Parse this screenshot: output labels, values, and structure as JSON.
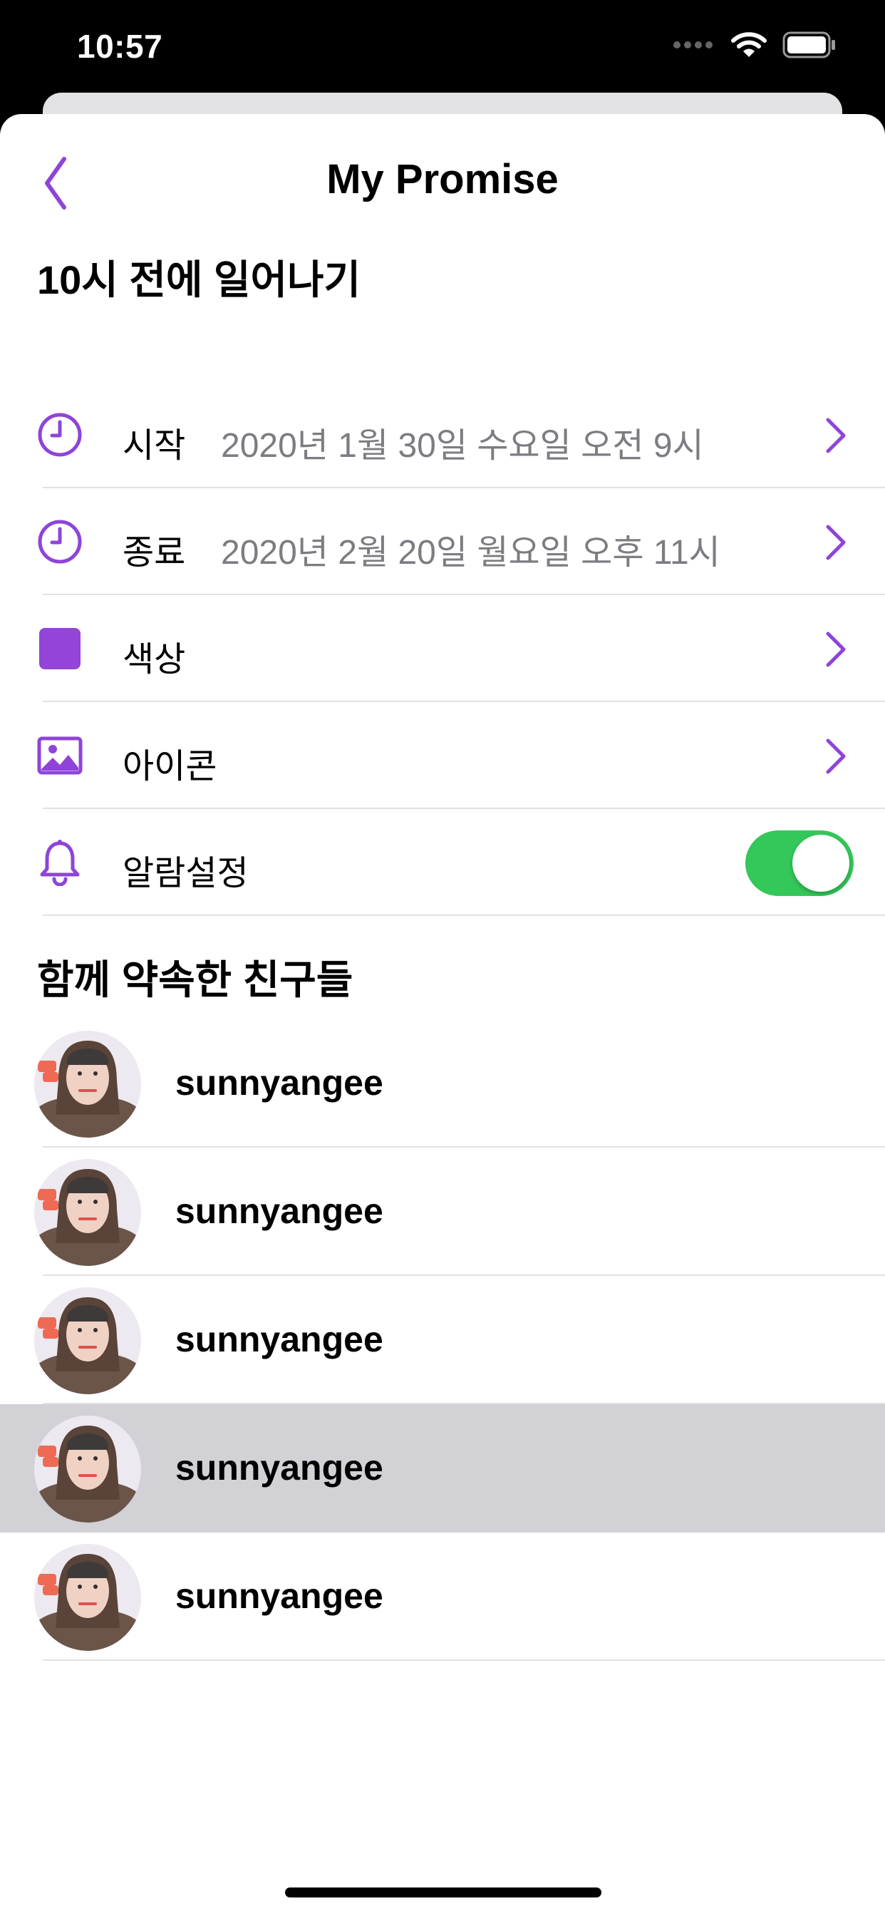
{
  "status_bar": {
    "time": "10:57"
  },
  "nav": {
    "title": "My Promise"
  },
  "promise": {
    "title": "10시 전에 일어나기",
    "rows": [
      {
        "label": "시작",
        "value": "2020년 1월 30일 수요일 오전 9시",
        "icon": "clock-icon"
      },
      {
        "label": "종료",
        "value": "2020년 2월 20일 월요일 오후 11시",
        "icon": "clock-icon"
      },
      {
        "label": "색상",
        "icon": "color-swatch-icon"
      },
      {
        "label": "아이콘",
        "icon": "image-icon"
      },
      {
        "label": "알람설정",
        "icon": "bell-icon",
        "toggle_on": true
      }
    ]
  },
  "friends": {
    "title": "함께 약속한 친구들",
    "items": [
      {
        "name": "sunnyangee"
      },
      {
        "name": "sunnyangee"
      },
      {
        "name": "sunnyangee"
      },
      {
        "name": "sunnyangee",
        "highlighted": true
      },
      {
        "name": "sunnyangee"
      }
    ]
  },
  "colors": {
    "accent": "#8e44d9",
    "swatch": "#9245d6",
    "toggle_on": "#34c759",
    "highlight_row": "#d1d1d6"
  }
}
